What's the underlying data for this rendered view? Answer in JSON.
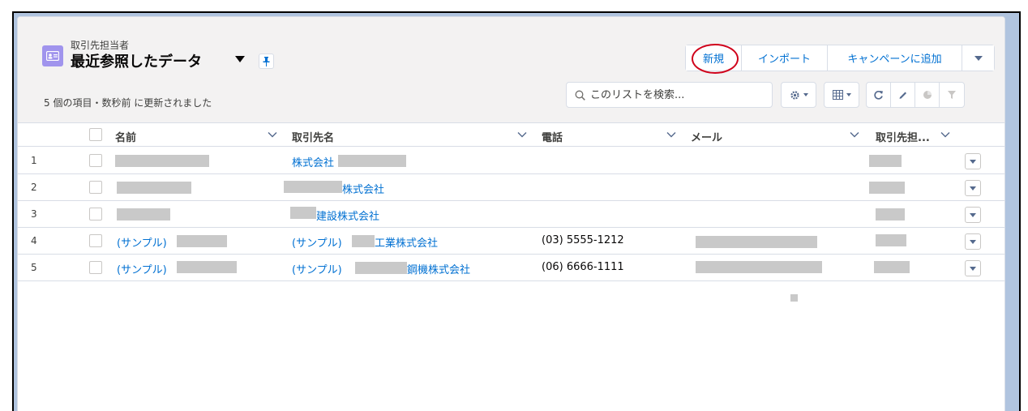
{
  "header": {
    "object_label": "取引先担当者",
    "list_view_title": "最近参照したデータ",
    "status_text": "5 個の項目・数秒前 に更新されました"
  },
  "actions": {
    "new_label": "新規",
    "import_label": "インポート",
    "add_campaign_label": "キャンペーンに追加"
  },
  "search": {
    "placeholder": "このリストを検索..."
  },
  "toolbar": {
    "icons": [
      "settings-gear-icon",
      "table-display-icon",
      "refresh-icon",
      "edit-pencil-icon",
      "chart-icon",
      "filter-icon"
    ]
  },
  "table": {
    "columns": [
      "名前",
      "取引先名",
      "電話",
      "メール",
      "取引先担..."
    ],
    "rows": [
      {
        "num": "1",
        "name": "",
        "account": "株式会社",
        "phone": "",
        "email": ""
      },
      {
        "num": "2",
        "name": "",
        "account": "株式会社",
        "phone": "",
        "email": ""
      },
      {
        "num": "3",
        "name": "",
        "account": "建設株式会社",
        "phone": "",
        "email": ""
      },
      {
        "num": "4",
        "name": "(サンプル)",
        "account_prefix": "(サンプル)",
        "account": "工業株式会社",
        "phone": "(03) 5555-1212",
        "email": ""
      },
      {
        "num": "5",
        "name": "(サンプル)",
        "account_prefix": "(サンプル)",
        "account": "鋼機株式会社",
        "phone": "(06) 6666-1111",
        "email": ""
      }
    ]
  },
  "colors": {
    "link": "#0070d2",
    "object_icon": "#a094ed",
    "highlight_circle": "#d0021b"
  }
}
